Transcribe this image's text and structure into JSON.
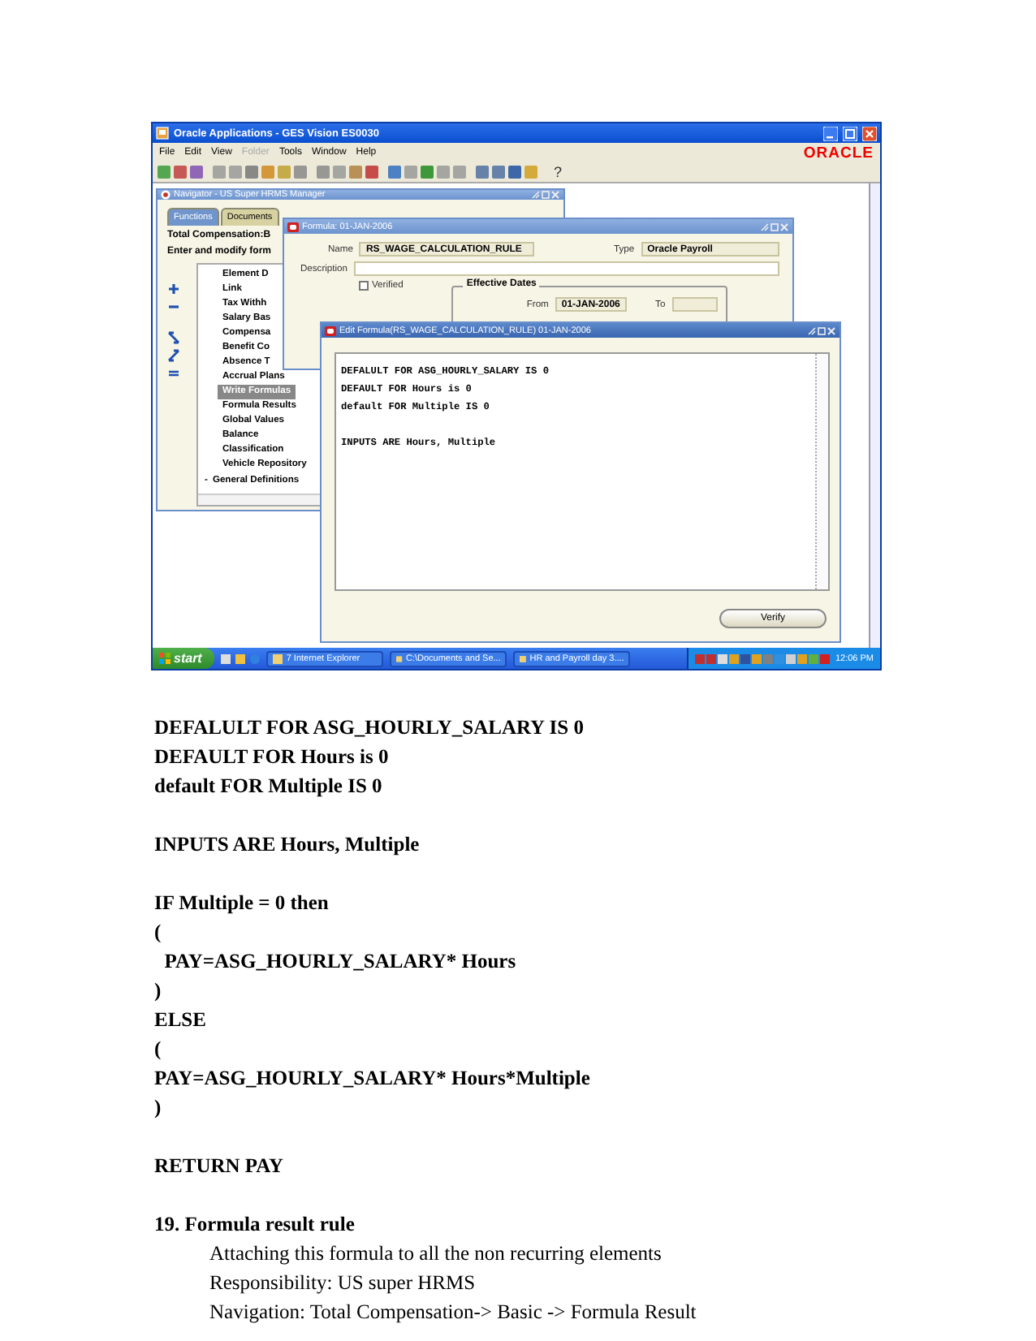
{
  "app": {
    "title": "Oracle Applications - GES Vision ES0030",
    "logo": "ORACLE",
    "menu": [
      {
        "label": "File",
        "disabled": false
      },
      {
        "label": "Edit",
        "disabled": false
      },
      {
        "label": "View",
        "disabled": false
      },
      {
        "label": "Folder",
        "disabled": true
      },
      {
        "label": "Tools",
        "disabled": false
      },
      {
        "label": "Window",
        "disabled": false
      },
      {
        "label": "Help",
        "disabled": false
      }
    ],
    "help_button": "?"
  },
  "navigator": {
    "title": "Navigator - US Super HRMS Manager",
    "tabs": [
      {
        "label": "Functions",
        "selected": true
      },
      {
        "label": "Documents",
        "selected": false
      }
    ],
    "heading": "Total Compensation:B",
    "instruction": "Enter and modify form",
    "items": [
      {
        "label": "Element D",
        "selected": false
      },
      {
        "label": "Link",
        "selected": false
      },
      {
        "label": "Tax Withh",
        "selected": false
      },
      {
        "label": "Salary Bas",
        "selected": false
      },
      {
        "label": "Compensa",
        "selected": false
      },
      {
        "label": "Benefit Co",
        "selected": false
      },
      {
        "label": "Absence T",
        "selected": false
      },
      {
        "label": "Accrual Plans",
        "selected": false
      },
      {
        "label": "Write Formulas",
        "selected": true
      },
      {
        "label": "Formula Results",
        "selected": false
      },
      {
        "label": "Global Values",
        "selected": false
      },
      {
        "label": "Balance",
        "selected": false
      },
      {
        "label": "Classification",
        "selected": false
      },
      {
        "label": "Vehicle Repository",
        "selected": false
      }
    ],
    "group": {
      "label": "General Definitions",
      "expanded": false,
      "marker": "-"
    }
  },
  "formula": {
    "title": "Formula: 01-JAN-2006",
    "name": {
      "label": "Name",
      "value": "RS_WAGE_CALCULATION_RULE"
    },
    "type": {
      "label": "Type",
      "value": "Oracle Payroll"
    },
    "description": {
      "label": "Description"
    },
    "verified": {
      "label": "Verified",
      "checked": false
    },
    "effective_dates": {
      "title": "Effective Dates",
      "from": {
        "label": "From",
        "value": "01-JAN-2006"
      },
      "to": {
        "label": "To"
      }
    }
  },
  "edit_formula": {
    "title": "Edit Formula(RS_WAGE_CALCULATION_RULE) 01-JAN-2006",
    "blocks": [
      [
        "DEFALULT FOR ASG_HOURLY_SALARY IS 0",
        "DEFAULT FOR Hours is 0",
        "default FOR Multiple IS 0"
      ],
      [
        "INPUTS ARE Hours, Multiple"
      ]
    ],
    "button": "Verify"
  },
  "taskbar": {
    "start": "start",
    "tasks": [
      "7 Internet Explorer",
      "C:\\Documents and Se...",
      "HR and Payroll day 3...."
    ],
    "clock": "12:06 PM"
  },
  "document": {
    "paragraphs": [
      {
        "kind": "code",
        "lines": [
          "DEFALULT FOR ASG_HOURLY_SALARY IS 0",
          "DEFAULT FOR Hours is 0",
          "default FOR Multiple IS 0"
        ]
      },
      {
        "kind": "code",
        "lines": [
          "INPUTS ARE Hours, Multiple"
        ]
      },
      {
        "kind": "code",
        "lines": [
          "IF Multiple = 0 then",
          "(",
          "  PAY=ASG_HOURLY_SALARY* Hours",
          ")",
          "ELSE",
          "(",
          "PAY=ASG_HOURLY_SALARY* Hours*Multiple",
          ")"
        ]
      },
      {
        "kind": "code",
        "lines": [
          "RETURN PAY"
        ]
      },
      {
        "kind": "heading",
        "lines": [
          "19. Formula result rule"
        ]
      },
      {
        "kind": "indented",
        "lines": [
          "Attaching this formula to all the non recurring elements",
          "Responsibility: US super HRMS",
          "Navigation: Total Compensation-> Basic -> Formula Result"
        ]
      }
    ]
  }
}
